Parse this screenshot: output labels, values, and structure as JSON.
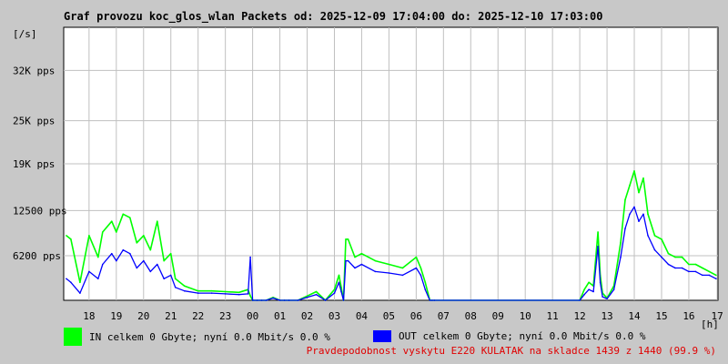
{
  "header": {
    "title": "Graf provozu koc_glos_wlan Packets od: 2025-12-09 17:04:00 do: 2025-12-10 17:03:00",
    "unit_label": "[/s]",
    "x_unit_label": "[h]"
  },
  "legend": {
    "in": {
      "text": "IN celkem 0 Gbyte; nyní   0.0 Mbit/s 0.0 %",
      "color": "#00ff00"
    },
    "out": {
      "text": "OUT celkem 0 Gbyte; nyní   0.0 Mbit/s 0.0 %",
      "color": "#0000ff"
    }
  },
  "footer": {
    "availability_text": "Pravdepodobnost vyskytu E220 KULATAK na skladce 1439 z 1440 (99.9 %)"
  },
  "colors": {
    "background": "#c8c8c8",
    "plot_area": "#ffffff",
    "grid": "#c0c0c0",
    "in_series": "#00ff00",
    "out_series": "#0000ff",
    "footer_text": "#e00000"
  },
  "chart_data": {
    "type": "area",
    "title": "Graf provozu koc_glos_wlan Packets od: 2025-12-09 17:04:00 do: 2025-12-10 17:03:00",
    "xlabel": "[h]",
    "ylabel": "[/s]",
    "xlim": [
      17.07,
      17.05
    ],
    "ylim": [
      0,
      38000
    ],
    "grid": true,
    "x_ticks": [
      "18",
      "19",
      "20",
      "21",
      "22",
      "23",
      "00",
      "01",
      "02",
      "03",
      "04",
      "05",
      "06",
      "07",
      "08",
      "09",
      "10",
      "11",
      "12",
      "13",
      "14",
      "15",
      "16",
      "17"
    ],
    "y_ticks": [
      {
        "value": 6200,
        "label": "6200 pps"
      },
      {
        "value": 12500,
        "label": "12500 pps"
      },
      {
        "value": 19000,
        "label": "19K pps"
      },
      {
        "value": 25000,
        "label": "25K pps"
      },
      {
        "value": 32000,
        "label": "32K pps"
      }
    ],
    "series": [
      {
        "name": "IN",
        "color": "#00ff00",
        "x": [
          "17:10",
          "17:20",
          "17:40",
          "18:00",
          "18:20",
          "18:30",
          "18:50",
          "19:00",
          "19:15",
          "19:30",
          "19:45",
          "20:00",
          "20:15",
          "20:30",
          "20:45",
          "21:00",
          "21:10",
          "21:30",
          "22:00",
          "22:30",
          "23:00",
          "23:30",
          "23:50",
          "23:55",
          "00:00",
          "00:10",
          "00:20",
          "00:30",
          "00:45",
          "01:00",
          "01:10",
          "01:20",
          "01:40",
          "02:00",
          "02:20",
          "02:40",
          "03:00",
          "03:10",
          "03:15",
          "03:20",
          "03:25",
          "03:30",
          "03:45",
          "04:00",
          "04:30",
          "05:00",
          "05:30",
          "06:00",
          "06:10",
          "06:20",
          "06:30",
          "06:35",
          "06:40",
          "12:00",
          "12:10",
          "12:20",
          "12:30",
          "12:40",
          "12:45",
          "12:50",
          "13:00",
          "13:15",
          "13:30",
          "13:40",
          "13:50",
          "14:00",
          "14:10",
          "14:20",
          "14:30",
          "14:45",
          "15:00",
          "15:15",
          "15:30",
          "15:45",
          "16:00",
          "16:15",
          "16:30",
          "16:45",
          "17:00"
        ],
        "values": [
          9000,
          8500,
          2500,
          9000,
          6000,
          9500,
          11000,
          9500,
          12000,
          11500,
          8000,
          9000,
          7000,
          11000,
          5500,
          6500,
          3000,
          2000,
          1300,
          1300,
          1200,
          1100,
          1500,
          600,
          0,
          0,
          0,
          0,
          400,
          0,
          0,
          0,
          0,
          600,
          1200,
          0,
          1500,
          3500,
          1800,
          0,
          8500,
          8500,
          6000,
          6500,
          5500,
          5000,
          4500,
          6000,
          4500,
          2500,
          0,
          0,
          0,
          0,
          1500,
          2500,
          2000,
          9500,
          3500,
          1000,
          300,
          2000,
          8000,
          14000,
          16000,
          18000,
          15000,
          17000,
          12000,
          9000,
          8500,
          6500,
          6000,
          6000,
          5000,
          5000,
          4500,
          4000,
          3500
        ]
      },
      {
        "name": "OUT",
        "color": "#0000ff",
        "x": [
          "17:10",
          "17:20",
          "17:40",
          "18:00",
          "18:20",
          "18:30",
          "18:50",
          "19:00",
          "19:15",
          "19:30",
          "19:45",
          "20:00",
          "20:15",
          "20:30",
          "20:45",
          "21:00",
          "21:10",
          "21:30",
          "22:00",
          "22:30",
          "23:00",
          "23:30",
          "23:50",
          "23:55",
          "00:00",
          "00:10",
          "00:20",
          "00:30",
          "00:45",
          "01:00",
          "01:10",
          "01:20",
          "01:40",
          "02:00",
          "02:20",
          "02:40",
          "03:00",
          "03:10",
          "03:15",
          "03:20",
          "03:25",
          "03:30",
          "03:45",
          "04:00",
          "04:30",
          "05:00",
          "05:30",
          "06:00",
          "06:10",
          "06:20",
          "06:30",
          "06:35",
          "06:40",
          "12:00",
          "12:10",
          "12:20",
          "12:30",
          "12:40",
          "12:45",
          "12:50",
          "13:00",
          "13:15",
          "13:30",
          "13:40",
          "13:50",
          "14:00",
          "14:10",
          "14:20",
          "14:30",
          "14:45",
          "15:00",
          "15:15",
          "15:30",
          "15:45",
          "16:00",
          "16:15",
          "16:30",
          "16:45",
          "17:00"
        ],
        "values": [
          3000,
          2500,
          1000,
          4000,
          3000,
          5000,
          6500,
          5500,
          7000,
          6500,
          4500,
          5500,
          4000,
          5000,
          3000,
          3500,
          1800,
          1300,
          1000,
          1000,
          900,
          800,
          900,
          6000,
          0,
          0,
          0,
          0,
          300,
          0,
          0,
          0,
          0,
          400,
          800,
          0,
          1000,
          2500,
          1200,
          0,
          5500,
          5500,
          4500,
          5000,
          4000,
          3800,
          3500,
          4500,
          3500,
          1500,
          0,
          0,
          0,
          0,
          800,
          1500,
          1200,
          7500,
          2500,
          500,
          200,
          1500,
          6000,
          10000,
          12000,
          13000,
          11000,
          12000,
          9000,
          7000,
          6000,
          5000,
          4500,
          4500,
          4000,
          4000,
          3500,
          3500,
          3000
        ]
      }
    ]
  }
}
